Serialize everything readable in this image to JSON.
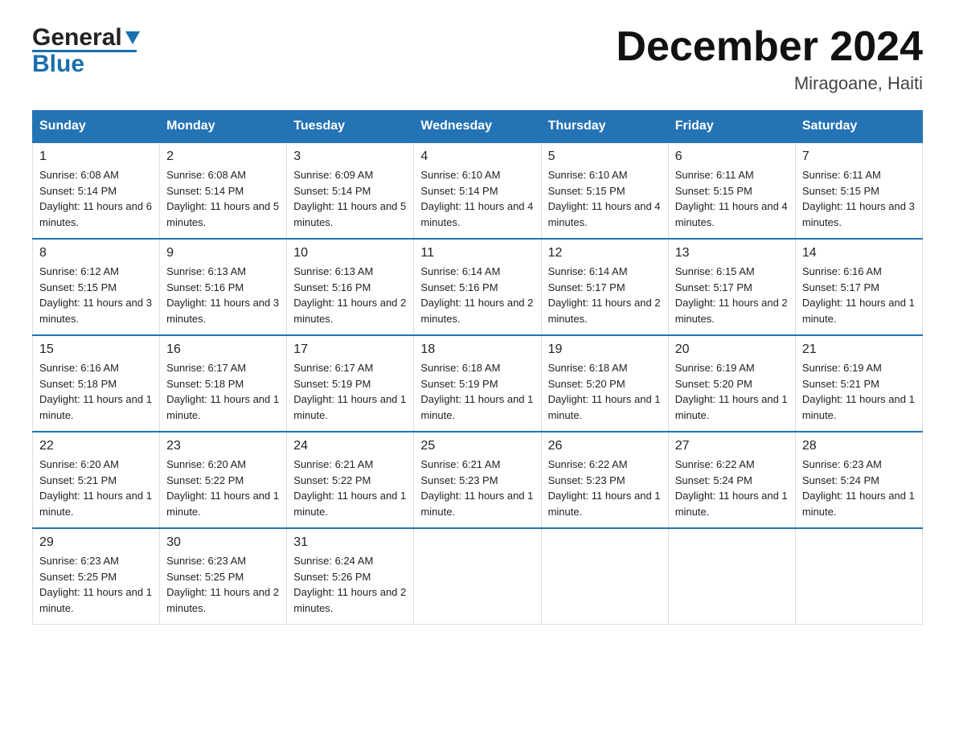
{
  "header": {
    "logo_general": "General",
    "logo_blue": "Blue",
    "title": "December 2024",
    "location": "Miragoane, Haiti"
  },
  "weekdays": [
    "Sunday",
    "Monday",
    "Tuesday",
    "Wednesday",
    "Thursday",
    "Friday",
    "Saturday"
  ],
  "weeks": [
    [
      {
        "day": "1",
        "sunrise": "6:08 AM",
        "sunset": "5:14 PM",
        "daylight": "11 hours and 6 minutes."
      },
      {
        "day": "2",
        "sunrise": "6:08 AM",
        "sunset": "5:14 PM",
        "daylight": "11 hours and 5 minutes."
      },
      {
        "day": "3",
        "sunrise": "6:09 AM",
        "sunset": "5:14 PM",
        "daylight": "11 hours and 5 minutes."
      },
      {
        "day": "4",
        "sunrise": "6:10 AM",
        "sunset": "5:14 PM",
        "daylight": "11 hours and 4 minutes."
      },
      {
        "day": "5",
        "sunrise": "6:10 AM",
        "sunset": "5:15 PM",
        "daylight": "11 hours and 4 minutes."
      },
      {
        "day": "6",
        "sunrise": "6:11 AM",
        "sunset": "5:15 PM",
        "daylight": "11 hours and 4 minutes."
      },
      {
        "day": "7",
        "sunrise": "6:11 AM",
        "sunset": "5:15 PM",
        "daylight": "11 hours and 3 minutes."
      }
    ],
    [
      {
        "day": "8",
        "sunrise": "6:12 AM",
        "sunset": "5:15 PM",
        "daylight": "11 hours and 3 minutes."
      },
      {
        "day": "9",
        "sunrise": "6:13 AM",
        "sunset": "5:16 PM",
        "daylight": "11 hours and 3 minutes."
      },
      {
        "day": "10",
        "sunrise": "6:13 AM",
        "sunset": "5:16 PM",
        "daylight": "11 hours and 2 minutes."
      },
      {
        "day": "11",
        "sunrise": "6:14 AM",
        "sunset": "5:16 PM",
        "daylight": "11 hours and 2 minutes."
      },
      {
        "day": "12",
        "sunrise": "6:14 AM",
        "sunset": "5:17 PM",
        "daylight": "11 hours and 2 minutes."
      },
      {
        "day": "13",
        "sunrise": "6:15 AM",
        "sunset": "5:17 PM",
        "daylight": "11 hours and 2 minutes."
      },
      {
        "day": "14",
        "sunrise": "6:16 AM",
        "sunset": "5:17 PM",
        "daylight": "11 hours and 1 minute."
      }
    ],
    [
      {
        "day": "15",
        "sunrise": "6:16 AM",
        "sunset": "5:18 PM",
        "daylight": "11 hours and 1 minute."
      },
      {
        "day": "16",
        "sunrise": "6:17 AM",
        "sunset": "5:18 PM",
        "daylight": "11 hours and 1 minute."
      },
      {
        "day": "17",
        "sunrise": "6:17 AM",
        "sunset": "5:19 PM",
        "daylight": "11 hours and 1 minute."
      },
      {
        "day": "18",
        "sunrise": "6:18 AM",
        "sunset": "5:19 PM",
        "daylight": "11 hours and 1 minute."
      },
      {
        "day": "19",
        "sunrise": "6:18 AM",
        "sunset": "5:20 PM",
        "daylight": "11 hours and 1 minute."
      },
      {
        "day": "20",
        "sunrise": "6:19 AM",
        "sunset": "5:20 PM",
        "daylight": "11 hours and 1 minute."
      },
      {
        "day": "21",
        "sunrise": "6:19 AM",
        "sunset": "5:21 PM",
        "daylight": "11 hours and 1 minute."
      }
    ],
    [
      {
        "day": "22",
        "sunrise": "6:20 AM",
        "sunset": "5:21 PM",
        "daylight": "11 hours and 1 minute."
      },
      {
        "day": "23",
        "sunrise": "6:20 AM",
        "sunset": "5:22 PM",
        "daylight": "11 hours and 1 minute."
      },
      {
        "day": "24",
        "sunrise": "6:21 AM",
        "sunset": "5:22 PM",
        "daylight": "11 hours and 1 minute."
      },
      {
        "day": "25",
        "sunrise": "6:21 AM",
        "sunset": "5:23 PM",
        "daylight": "11 hours and 1 minute."
      },
      {
        "day": "26",
        "sunrise": "6:22 AM",
        "sunset": "5:23 PM",
        "daylight": "11 hours and 1 minute."
      },
      {
        "day": "27",
        "sunrise": "6:22 AM",
        "sunset": "5:24 PM",
        "daylight": "11 hours and 1 minute."
      },
      {
        "day": "28",
        "sunrise": "6:23 AM",
        "sunset": "5:24 PM",
        "daylight": "11 hours and 1 minute."
      }
    ],
    [
      {
        "day": "29",
        "sunrise": "6:23 AM",
        "sunset": "5:25 PM",
        "daylight": "11 hours and 1 minute."
      },
      {
        "day": "30",
        "sunrise": "6:23 AM",
        "sunset": "5:25 PM",
        "daylight": "11 hours and 2 minutes."
      },
      {
        "day": "31",
        "sunrise": "6:24 AM",
        "sunset": "5:26 PM",
        "daylight": "11 hours and 2 minutes."
      },
      null,
      null,
      null,
      null
    ]
  ]
}
